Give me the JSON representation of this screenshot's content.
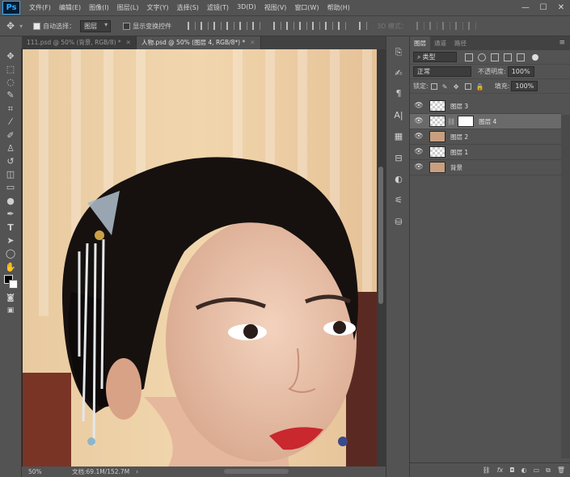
{
  "app": {
    "logo": "Ps"
  },
  "menubar": {
    "items": [
      "文件(F)",
      "编辑(E)",
      "图像(I)",
      "图层(L)",
      "文字(Y)",
      "选择(S)",
      "滤镜(T)",
      "3D(D)",
      "视图(V)",
      "窗口(W)",
      "帮助(H)"
    ],
    "window_buttons": [
      "—",
      "☐",
      "✕"
    ]
  },
  "options": {
    "auto_select_label": "自动选择：",
    "auto_select_value": "图层",
    "show_transform_label": "显示变换控件",
    "mode_3d_label": "3D 模式："
  },
  "tabs": [
    {
      "label": "111.psd @ 50% (背景, RGB/8) *",
      "close": "✕"
    },
    {
      "label": "人物.psd @ 50% (图层 4, RGB/8*) *",
      "close": "✕"
    }
  ],
  "status": {
    "zoom": "50%",
    "doc": "文档:69.1M/152.7M",
    "arrow": "›"
  },
  "panel": {
    "tabs": [
      "图层",
      "通道",
      "路径"
    ],
    "filter_kind": "类型",
    "blend_mode": "正常",
    "opacity_label": "不透明度:",
    "opacity_value": "100%",
    "lock_label": "锁定:",
    "fill_label": "填充:",
    "fill_value": "100%",
    "layers": [
      {
        "name": "图层 3"
      },
      {
        "name": "图层 4"
      },
      {
        "name": "图层 2"
      },
      {
        "name": "图层 1"
      },
      {
        "name": "背景"
      }
    ],
    "bottom_icons": [
      "link-icon",
      "fx-icon",
      "mask-icon",
      "adjustment-icon",
      "group-icon",
      "new-layer-icon",
      "trash-icon"
    ],
    "fx_label": "fx"
  },
  "colors": {
    "ui_bg": "#535353",
    "canvas_bg": "#282828",
    "selected_layer": "#6a6a6a"
  }
}
